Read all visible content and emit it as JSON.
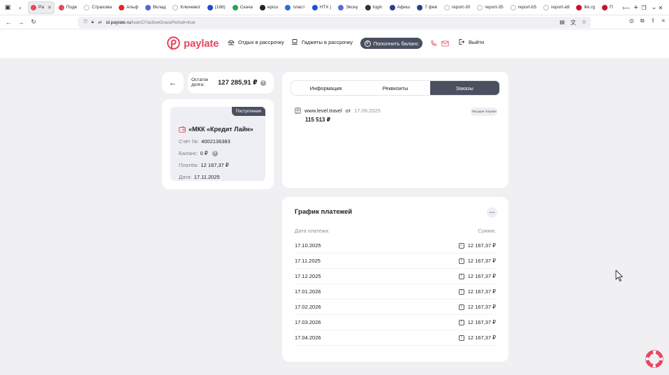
{
  "browser": {
    "tabs": [
      {
        "label": "Pa",
        "active": true,
        "color": "#e9475f"
      },
      {
        "label": "Поде",
        "color": "#e9475f"
      },
      {
        "label": "Страхова",
        "color": "#ffffff"
      },
      {
        "label": "Альф",
        "color": "#e3242b"
      },
      {
        "label": "Вклад",
        "color": "#4f6bd6"
      },
      {
        "label": "Ключевої",
        "color": "#ffffff"
      },
      {
        "label": "(166)",
        "color": "#1a4fc4"
      },
      {
        "label": "Скача",
        "color": "#22a35a"
      },
      {
        "label": "epicu",
        "color": "#222222"
      },
      {
        "label": "пласт",
        "color": "#2b6fd6"
      },
      {
        "label": "HTX |",
        "color": "#1a53d6"
      },
      {
        "label": "Эксну",
        "color": "#5b6bd6"
      },
      {
        "label": "login",
        "color": "#333333"
      },
      {
        "label": "Афиш",
        "color": "#2b3e8a"
      },
      {
        "label": "7 фев",
        "color": "#2b3e8a"
      },
      {
        "label": "report-30",
        "color": "#ffffff"
      },
      {
        "label": "report-35",
        "color": "#ffffff"
      },
      {
        "label": "report-b5",
        "color": "#ffffff"
      },
      {
        "label": "report-a9",
        "color": "#ffffff"
      },
      {
        "label": "lkk.rg",
        "color": "#c8102e"
      },
      {
        "label": "П",
        "color": "#c8102e"
      }
    ],
    "url_host": "id.paylate.ru",
    "url_path": "/loanCl?activeGracePeriod=true"
  },
  "header": {
    "logo_text": "paylate",
    "nav": {
      "installments": "Отдых в рассрочку",
      "gadgets": "Гаджеты в рассрочку",
      "topup": "Пополнить баланс",
      "logout": "Выйти"
    },
    "brand_color": "#e9475f",
    "accent_dark": "#4a5060"
  },
  "debt": {
    "label": "Остаток долга:",
    "value": "127 285,91 ₽"
  },
  "loan": {
    "badge": "Поступления",
    "title": "«МКК «Кредит Лайн»",
    "account_label": "Счёт №:",
    "account_value": "4002136383",
    "balance_label": "Баланс:",
    "balance_value": "0 ₽",
    "payment_label": "Платёж:",
    "payment_value": "12 167,37 ₽",
    "date_label": "Дата:",
    "date_value": "17.11.2025"
  },
  "tabs": {
    "info": "Информация",
    "requisites": "Реквизиты",
    "orders": "Заказы"
  },
  "order": {
    "merchant": "www.level.travel",
    "from": "от",
    "date": "17.09.2025",
    "amount": "115 513 ₽",
    "badge": "Текущие покупки"
  },
  "schedule": {
    "title": "График платежей",
    "col_date": "Дата платежа:",
    "col_sum": "Сумма:",
    "rows": [
      {
        "date": "17.10.2025",
        "amount": "12 167,37 ₽",
        "paid": true
      },
      {
        "date": "17.11.2025",
        "amount": "12 167,37 ₽",
        "paid": false
      },
      {
        "date": "17.12.2025",
        "amount": "12 167,37 ₽",
        "paid": false
      },
      {
        "date": "17.01.2026",
        "amount": "12 167,37 ₽",
        "paid": false
      },
      {
        "date": "17.02.2026",
        "amount": "12 167,37 ₽",
        "paid": false
      },
      {
        "date": "17.03.2026",
        "amount": "12 167,37 ₽",
        "paid": false
      },
      {
        "date": "17.04.2026",
        "amount": "12 167,37 ₽",
        "paid": false
      }
    ]
  }
}
